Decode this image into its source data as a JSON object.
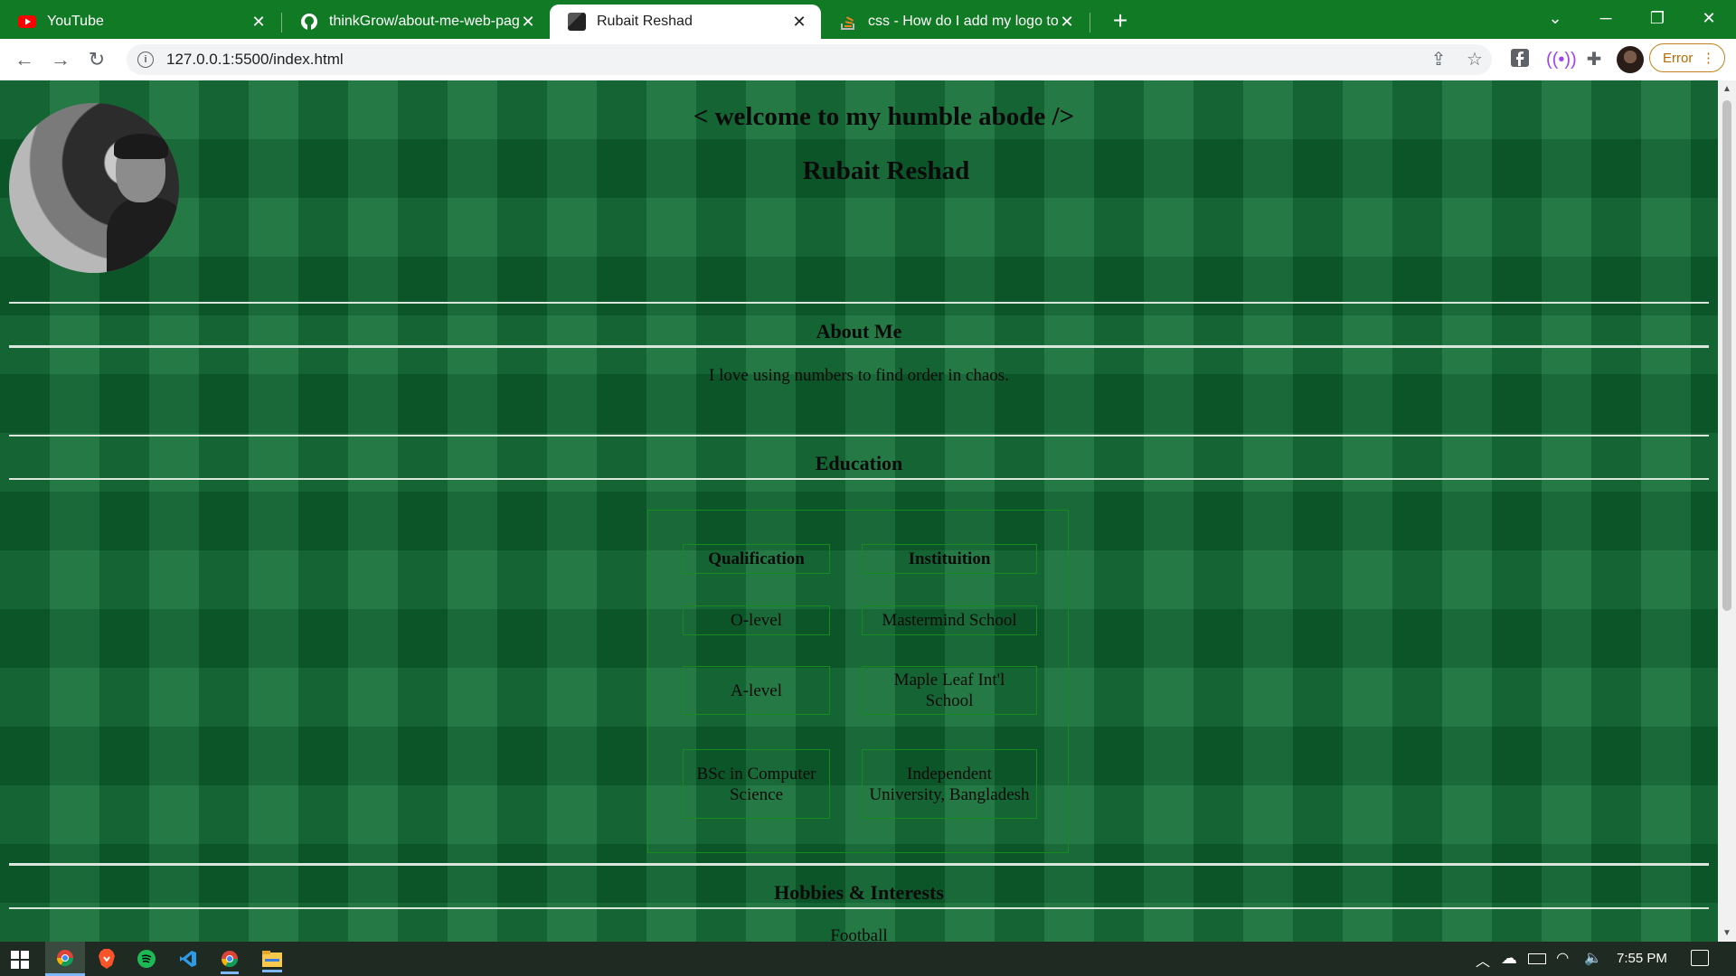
{
  "browser": {
    "tabs": [
      {
        "title": "YouTube",
        "icon": "youtube-icon",
        "active": false
      },
      {
        "title": "thinkGrow/about-me-web-page",
        "icon": "github-icon",
        "active": false
      },
      {
        "title": "Rubait Reshad",
        "icon": "profile-favicon",
        "active": true
      },
      {
        "title": "css - How do I add my logo to m",
        "icon": "stackoverflow-icon",
        "active": false
      }
    ],
    "url": "127.0.0.1:5500/index.html",
    "error_label": "Error"
  },
  "page": {
    "greeting": "< welcome to my humble abode />",
    "name": "Rubait Reshad",
    "about": {
      "title": "About Me",
      "text": "I love using numbers to find order in chaos."
    },
    "education": {
      "title": "Education",
      "headers": [
        "Qualification",
        "Instituition"
      ],
      "rows": [
        [
          "O-level",
          "Mastermind School"
        ],
        [
          "A-level",
          "Maple Leaf Int'l School"
        ],
        [
          "BSc in Computer Science",
          "Independent University, Bangladesh"
        ]
      ]
    },
    "hobbies": {
      "title": "Hobbies & Interests",
      "first_item": "Football"
    }
  },
  "taskbar": {
    "time": "7:55 PM"
  },
  "colors": {
    "tab_strip": "#117a25",
    "page_bg": "#0f6c33",
    "table_border": "#178a22"
  }
}
